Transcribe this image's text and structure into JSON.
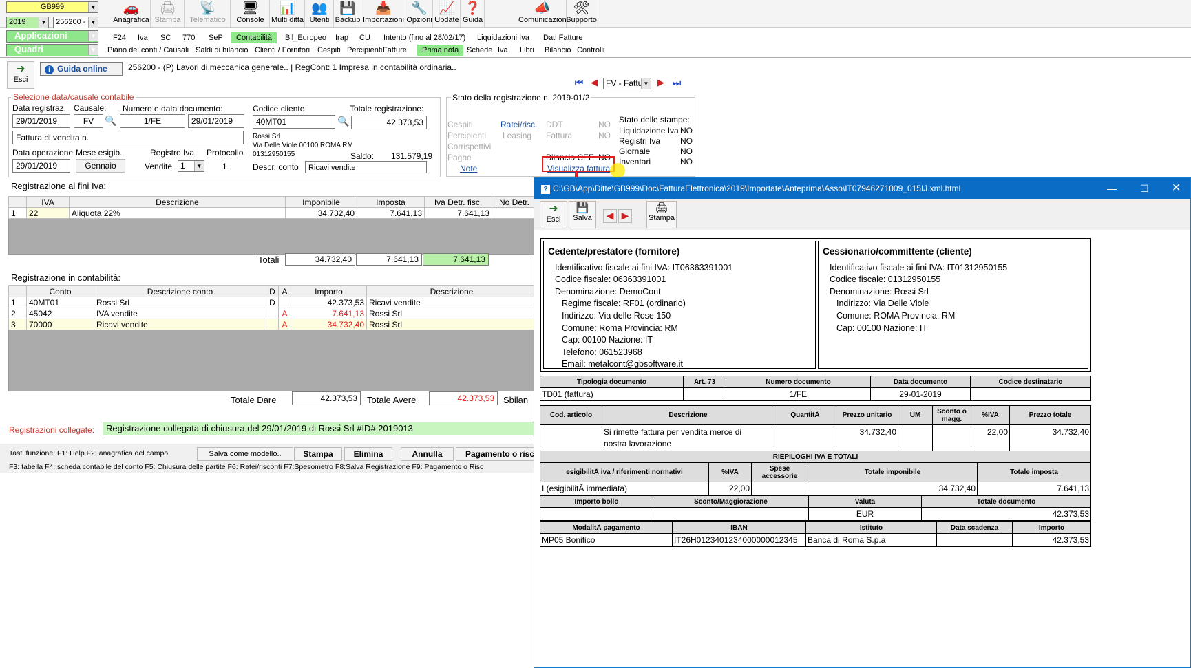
{
  "top": {
    "company": "GB999",
    "year": "2019",
    "client": "256200 -",
    "apps": "Applicazioni",
    "quadri": "Quadri"
  },
  "toolbar": [
    "Anagrafica",
    "Stampa",
    "Telematico",
    "Console",
    "Multi ditta",
    "Utenti",
    "Backup",
    "Importazioni",
    "Opzioni",
    "Update",
    "Guida",
    "Comunicazioni",
    "Supporto"
  ],
  "menu1": [
    "F24",
    "Iva",
    "SC",
    "770",
    "SeP",
    "Contabilità",
    "Bil_Europeo",
    "Irap",
    "CU",
    "Intento (fino al 28/02/17)",
    "Liquidazioni Iva",
    "Dati Fatture"
  ],
  "menu2": [
    "Piano dei conti / Causali",
    "Saldi di bilancio",
    "Clienti / Fornitori",
    "Cespiti",
    "Percipienti",
    "Fatture",
    "Prima nota",
    "Schede",
    "Iva",
    "Libri",
    "Bilancio",
    "Controlli"
  ],
  "header": {
    "esci": "Esci",
    "guida": "Guida online",
    "company_line": "256200 - (P) Lavori di meccanica generale.. | RegCont: 1 Impresa  in contabilità ordinaria..",
    "nav_doc": "FV - Fattu"
  },
  "sel": {
    "title": "Selezione data/causale contabile",
    "lbl_data": "Data registraz.",
    "lbl_causale": "Causale:",
    "lbl_numero": "Numero e data documento:",
    "data": "29/01/2019",
    "causale": "FV",
    "numero": "1/FE",
    "data_doc": "29/01/2019",
    "descr": "Fattura di vendita n.",
    "lbl_op": "Data operazione",
    "lbl_mese": "Mese esigib.",
    "lbl_reg": "Registro Iva",
    "lbl_prot": "Protocollo",
    "data_op": "29/01/2019",
    "mese": "Gennaio",
    "reg_lbl": "Vendite",
    "reg": "1",
    "prot": "1"
  },
  "cli": {
    "lbl_codice": "Codice cliente",
    "lbl_totale": "Totale registrazione:",
    "codice": "40MT01",
    "totale": "42.373,53",
    "nome": "Rossi Srl",
    "addr": "Via Delle Viole 00100 ROMA RM",
    "piva": "01312950155",
    "lbl_saldo": "Saldo:",
    "saldo": "131.579,19",
    "lbl_descr": "Descr. conto",
    "descr": "Ricavi vendite"
  },
  "stato": {
    "title": "Stato della registrazione n. 2019-01/2",
    "cells": [
      "Cespiti",
      "Ratei/risc.",
      "DDT",
      "NO",
      "Percipienti",
      "Leasing",
      "Fattura",
      "NO",
      "Corrispettivi",
      "Paghe",
      "Bilancio CEE",
      "NO",
      "Note",
      "Visualizza fattura"
    ],
    "stampe_title": "Stato delle stampe:",
    "stampe": [
      [
        "Liquidazione Iva",
        "NO"
      ],
      [
        "Registri Iva",
        "NO"
      ],
      [
        "Giornale",
        "NO"
      ],
      [
        "Inventari",
        "NO"
      ]
    ]
  },
  "iva": {
    "title": "Registrazione ai fini Iva:",
    "cols": [
      "IVA",
      "Descrizione",
      "Imponibile",
      "Imposta",
      "Iva Detr. fisc.",
      "No Detr."
    ],
    "row": [
      "1",
      "22",
      "Aliquota 22%",
      "34.732,40",
      "7.641,13",
      "7.641,13"
    ],
    "tot_lbl": "Totali",
    "tot": [
      "34.732,40",
      "7.641,13",
      "7.641,13"
    ]
  },
  "cont": {
    "title": "Registrazione in contabilità:",
    "cols": [
      "Conto",
      "Descrizione conto",
      "D",
      "A",
      "Importo",
      "Descrizione"
    ],
    "rows": [
      [
        "1",
        "40MT01",
        "Rossi Srl",
        "D",
        "",
        "42.373,53",
        "Ricavi vendite"
      ],
      [
        "2",
        "45042",
        "IVA vendite",
        "",
        "A",
        "7.641,13",
        "Rossi Srl"
      ],
      [
        "3",
        "70000",
        "Ricavi vendite",
        "",
        "A",
        "34.732,40",
        "Rossi Srl"
      ]
    ],
    "dare_lbl": "Totale Dare",
    "dare": "42.373,53",
    "avere_lbl": "Totale Avere",
    "avere": "42.373,53",
    "sbil": "Sbilan"
  },
  "coll": {
    "lbl": "Registrazioni collegate:",
    "val": "Registrazione collegata di chiusura del 29/01/2019 di Rossi Srl #ID# 2019013"
  },
  "foot": {
    "line1": "Tasti funzione:  F1: Help   F2: anagrafica del campo",
    "line2": "F3: tabella    F4: scheda contabile del conto   F5: Chiusura delle partite       F6: Ratei/risconti   F7:Spesometro    F8:Salva Registrazione      F9: Pagamento o Risc",
    "modello": "Salva come modello..",
    "stampa": "Stampa",
    "elimina": "Elimina",
    "annulla": "Annulla",
    "pag": "Pagamento o risc"
  },
  "win": {
    "title": "C:\\GB\\App\\Ditte\\GB999\\Doc\\FatturaElettronica\\2019\\Importate\\Anteprima\\Asso\\IT07946271009_015IJ.xml.html",
    "esci": "Esci",
    "salva": "Salva",
    "stampa": "Stampa"
  },
  "ced": {
    "title": "Cedente/prestatore (fornitore)",
    "lines": [
      "Identificativo fiscale ai fini IVA: IT06363391001",
      "Codice fiscale: 06363391001",
      "Denominazione: DemoCont"
    ],
    "sub": [
      "Regime fiscale: RF01 (ordinario)",
      "Indirizzo: Via delle Rose 150",
      "Comune: Roma Provincia: RM",
      "Cap: 00100 Nazione: IT",
      "Telefono: 061523968",
      "Email: metalcont@gbsoftware.it"
    ]
  },
  "ces": {
    "title": "Cessionario/committente (cliente)",
    "lines": [
      "Identificativo fiscale ai fini IVA: IT01312950155",
      "Codice fiscale: 01312950155",
      "Denominazione: Rossi Srl"
    ],
    "sub": [
      "Indirizzo: Via Delle Viole",
      "Comune: ROMA Provincia: RM",
      "Cap: 00100 Nazione: IT"
    ]
  },
  "doc": {
    "h": [
      "Tipologia documento",
      "Art. 73",
      "Numero documento",
      "Data documento",
      "Codice destinatario"
    ],
    "v": [
      "TD01 (fattura)",
      "",
      "1/FE",
      "29-01-2019",
      ""
    ]
  },
  "righe": {
    "h": [
      "Cod. articolo",
      "Descrizione",
      "QuantitÃ",
      "Prezzo unitario",
      "UM",
      "Sconto o magg.",
      "%IVA",
      "Prezzo totale"
    ],
    "desc1": "Si rimette fattura per vendita merce di",
    "desc2": "nostra lavorazione",
    "prezzo": "34.732,40",
    "iva": "22,00",
    "totale": "34.732,40"
  },
  "riep": {
    "title": "RIEPILOGHI IVA E TOTALI",
    "h": [
      "esigibilitÃ  iva / riferimenti normativi",
      "%IVA",
      "Spese accessorie",
      "Totale imponibile",
      "Totale imposta"
    ],
    "v": [
      "I (esigibilitÃ  immediata)",
      "22,00",
      "",
      "34.732,40",
      "7.641,13"
    ],
    "h2": [
      "Importo bollo",
      "Sconto/Maggiorazione",
      "Valuta",
      "Totale documento"
    ],
    "v2": [
      "",
      "",
      "EUR",
      "42.373,53"
    ],
    "h3": [
      "ModalitÃ  pagamento",
      "IBAN",
      "Istituto",
      "Data scadenza",
      "Importo"
    ],
    "v3": [
      "MP05 Bonifico",
      "IT26H0123401234000000012345",
      "Banca di Roma S.p.a",
      "",
      "42.373,53"
    ]
  },
  "colors": {
    "accent_green": "#8ee88a",
    "title_blue": "#0a6cc5",
    "highlight_red": "#e02020"
  }
}
